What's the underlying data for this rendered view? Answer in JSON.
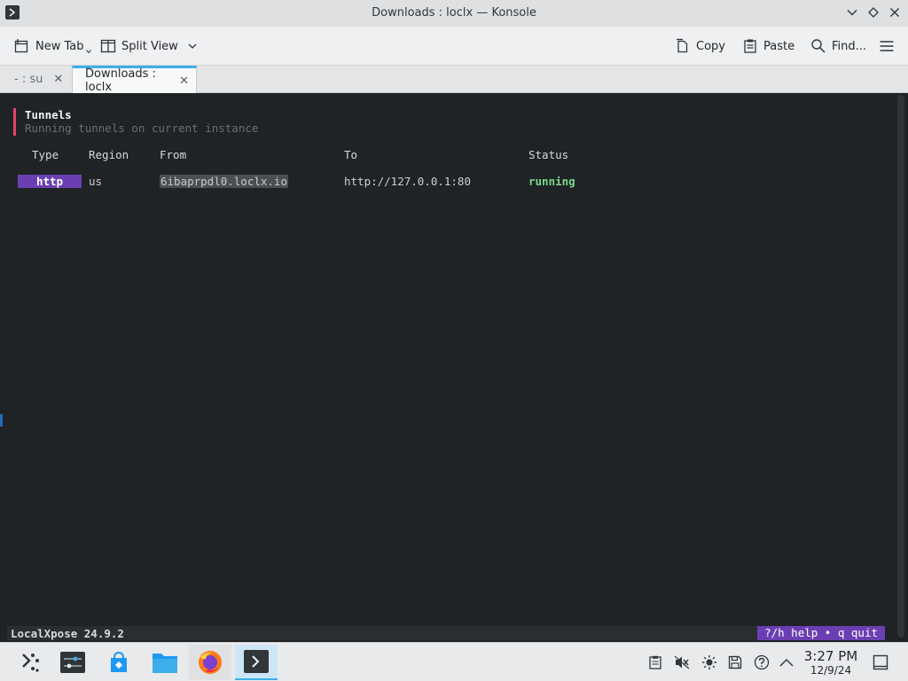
{
  "window": {
    "title": "Downloads : loclx — Konsole"
  },
  "toolbar": {
    "new_tab": "New Tab",
    "split_view": "Split View",
    "copy": "Copy",
    "paste": "Paste",
    "find": "Find..."
  },
  "tabs": [
    {
      "label": "- : su",
      "active": false
    },
    {
      "label": "Downloads : loclx",
      "active": true
    }
  ],
  "terminal": {
    "heading": "Tunnels",
    "subheading": "Running tunnels on current instance",
    "columns": [
      "Type",
      "Region",
      "From",
      "To",
      "Status"
    ],
    "rows": [
      {
        "type": "http",
        "region": "us",
        "from": "6ibaprpdl0.loclx.io",
        "to": "http://127.0.0.1:80",
        "status": "running"
      }
    ],
    "status_left": "LocalXpose 24.9.2",
    "status_right": "?/h help • q quit"
  },
  "taskbar": {
    "clock_time": "3:27 PM",
    "clock_date": "12/9/24"
  },
  "colors": {
    "accent_bar": "#e0446a",
    "badge": "#6b3fb3",
    "running": "#7dd68a",
    "terminal_bg": "#1f2326",
    "tab_accent": "#3daee9"
  }
}
